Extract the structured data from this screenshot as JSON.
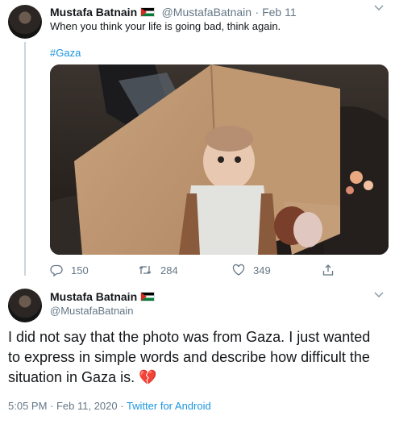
{
  "tweet1": {
    "name": "Mustafa Batnain",
    "handle": "@MustafaBatnain",
    "date": "· Feb 11",
    "text": "When you think your life is going bad, think again.",
    "hashtag": "#Gaza",
    "replies": "150",
    "retweets": "284",
    "likes": "349"
  },
  "tweet2": {
    "name": "Mustafa Batnain",
    "handle": "@MustafaBatnain",
    "text": "I did not say that the photo was from Gaza. I just wanted to express in simple words and describe how difficult the situation in Gaza is.",
    "emoji": "💔",
    "time": "5:05 PM · Feb 11, 2020 · ",
    "source": "Twitter for Android"
  },
  "colors": {
    "link": "#1b95e0",
    "muted": "#657786",
    "thread": "#ccd6dd"
  },
  "icons": [
    "reply-icon",
    "retweet-icon",
    "like-icon",
    "share-icon",
    "chevron-down-icon",
    "palestine-flag-icon",
    "broken-heart-icon"
  ]
}
